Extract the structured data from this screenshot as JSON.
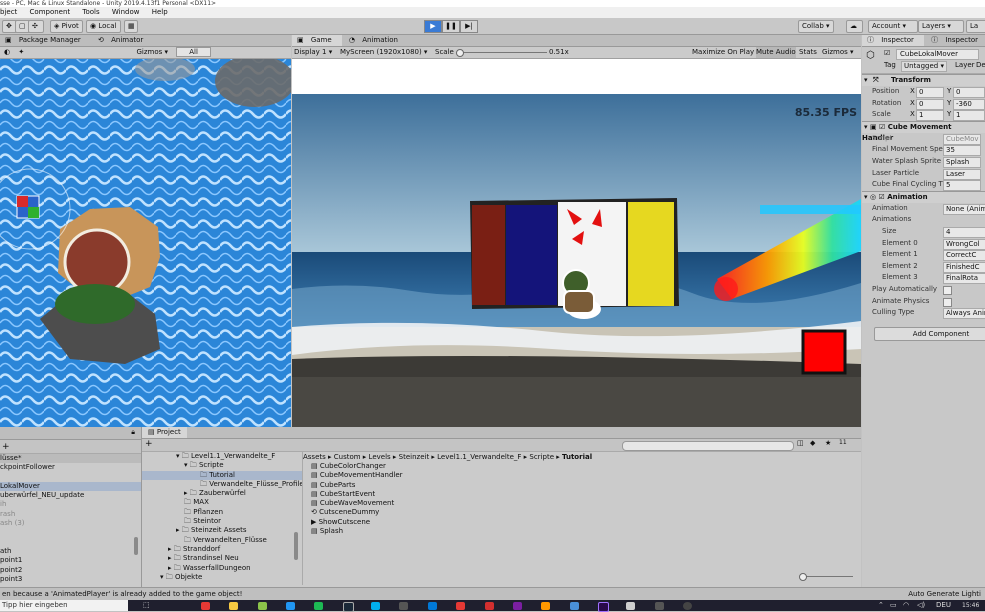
{
  "window_title": "sse - PC, Mac & Linux Standalone - Unity 2019.4.13f1 Personal <DX11>",
  "menu": [
    "bject",
    "Component",
    "Tools",
    "Window",
    "Help"
  ],
  "toolbar": {
    "pivot": "Pivot",
    "local": "Local",
    "collab": "Collab ▾",
    "account": "Account ▾",
    "layers": "Layers ▾",
    "layout": "La"
  },
  "left_scene": {
    "tabs": [
      "Package Manager",
      "Animator"
    ],
    "gizmos": "Gizmos ▾",
    "search_placeholder": "All"
  },
  "game_view": {
    "tabs": [
      "Game",
      "Animation"
    ],
    "display": "Display 1 ▾",
    "resolution": "MyScreen (1920x1080) ▾",
    "scale_label": "Scale",
    "scale_value": "0.51x",
    "toggles": [
      "Maximize On Play",
      "Mute Audio",
      "Stats",
      "Gizmos ▾"
    ],
    "fps": "85.35 FPS"
  },
  "hierarchy": {
    "header": "lüsse*",
    "items": [
      "ckpointFollower",
      "",
      "LokalMover",
      "uberwürfel_NEU_update",
      "ih",
      "rash",
      "ash (3)",
      "",
      "",
      "ath",
      "point1",
      "point2",
      "point3"
    ]
  },
  "project": {
    "tab": "Project",
    "folders": [
      "Level1.1_Verwandelte_F",
      "Scripte",
      "Tutorial",
      "Verwandelte_Flüsse_Profile",
      "Zauberwürfel",
      "MAX",
      "Pflanzen",
      "Steintor",
      "Steinzeit Assets",
      "Verwandelten_Flüsse",
      "Stranddorf",
      "Strandinsel Neu",
      "WasserfallDungeon",
      "Objekte"
    ],
    "breadcrumb": [
      "Assets",
      "Custom",
      "Levels",
      "Steinzeit",
      "Level1.1_Verwandelte_F",
      "Scripte",
      "Tutorial"
    ],
    "files": [
      "CubeColorChanger",
      "CubeMovementHandler",
      "CubeParts",
      "CubeStartEvent",
      "CubeWaveMovement",
      "CutsceneDummy",
      "ShowCutscene",
      "Splash"
    ],
    "count": "11"
  },
  "inspector": {
    "tabs": [
      "Inspector",
      "Inspector"
    ],
    "object_name": "CubeLokalMover",
    "tag_label": "Tag",
    "tag_value": "Untagged ▾",
    "layer_label": "Layer",
    "layer_value": "De",
    "transform": {
      "title": "Transform",
      "rows": [
        {
          "label": "Position",
          "x": "0",
          "y": "0"
        },
        {
          "label": "Rotation",
          "x": "0",
          "y": "-360"
        },
        {
          "label": "Scale",
          "x": "1",
          "y": "1"
        }
      ]
    },
    "cube_handler": {
      "title": "Cube Movement Handler",
      "rows": [
        {
          "label": "Script",
          "value": "CubeMov"
        },
        {
          "label": "Final Movement Spe",
          "value": "35"
        },
        {
          "label": "Water Splash Sprite",
          "value": "Splash"
        },
        {
          "label": "Laser Particle",
          "value": "Laser"
        },
        {
          "label": "Cube Final Cycling Ti",
          "value": "5"
        }
      ]
    },
    "animation": {
      "title": "Animation",
      "rows": [
        {
          "label": "Animation",
          "value": "None (Anima"
        },
        {
          "label": "Animations",
          "value": ""
        },
        {
          "label": "Size",
          "value": "4"
        },
        {
          "label": "Element 0",
          "value": "WrongCol"
        },
        {
          "label": "Element 1",
          "value": "CorrectC"
        },
        {
          "label": "Element 2",
          "value": "FinishedC"
        },
        {
          "label": "Element 3",
          "value": "FinalRota"
        },
        {
          "label": "Play Automatically",
          "value": ""
        },
        {
          "label": "Animate Physics",
          "value": ""
        },
        {
          "label": "Culling Type",
          "value": "Always Anim"
        }
      ]
    },
    "add_component": "Add Component"
  },
  "status_bar": {
    "message": "en because a 'AnimatedPlayer' is already added to the game object!",
    "right": "Auto Generate Lighti"
  },
  "taskbar": {
    "search": "Tipp hier eingeben",
    "lang": "DEU",
    "time": "15:46"
  },
  "colors": {
    "water": "#2a7fd0",
    "sky": "#4f86b0",
    "cube_red": "#7a1f14",
    "cube_blue": "#14147a",
    "cube_yellow": "#e6d820",
    "red_square": "#ff0000"
  }
}
